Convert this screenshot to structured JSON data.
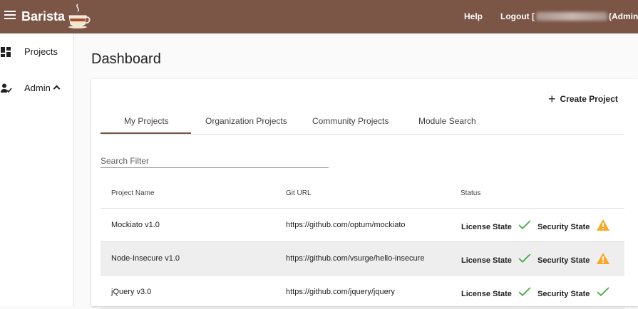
{
  "app": {
    "title": "Barista",
    "logo_icon": "coffee-cup-icon",
    "brand_color": "#7b5546"
  },
  "header": {
    "help_label": "Help",
    "logout_prefix": "Logout [",
    "logout_suffix": "(Admin)]"
  },
  "sidebar": {
    "items": [
      {
        "label": "Projects",
        "icon": "dashboard-icon"
      },
      {
        "label": "Admin",
        "icon": "admin-user-check-icon",
        "expanded": true
      }
    ]
  },
  "main": {
    "title": "Dashboard",
    "create_label": "Create Project",
    "tabs": [
      {
        "label": "My Projects",
        "active": true
      },
      {
        "label": "Organization Projects",
        "active": false
      },
      {
        "label": "Community Projects",
        "active": false
      },
      {
        "label": "Module Search",
        "active": false
      }
    ],
    "search_placeholder": "Search Filter"
  },
  "table": {
    "columns": [
      "Project Name",
      "Git URL",
      "Status"
    ],
    "license_label": "License State",
    "security_label": "Security State",
    "rows": [
      {
        "name": "Mockiato v1.0",
        "url": "https://github.com/optum/mockiato",
        "license": "ok",
        "security": "warning"
      },
      {
        "name": "Node-Insecure v1.0",
        "url": "https://github.com/vsurge/hello-insecure",
        "license": "ok",
        "security": "warning"
      },
      {
        "name": "jQuery v3.0",
        "url": "https://github.com/jquery/jquery",
        "license": "ok",
        "security": "ok"
      }
    ]
  },
  "colors": {
    "ok": "#4caf50",
    "warning": "#f9a825"
  }
}
